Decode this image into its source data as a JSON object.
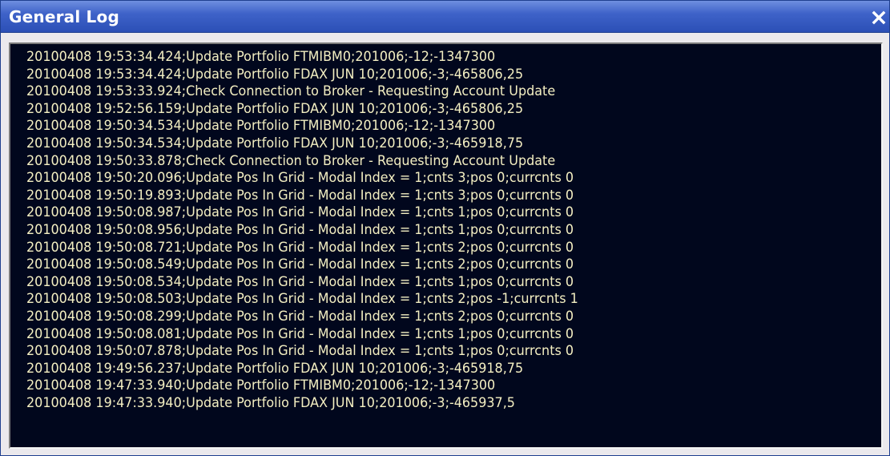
{
  "window": {
    "title": "General Log",
    "close_icon": "close-icon"
  },
  "colors": {
    "titlebar": "#3f63c9",
    "log_background": "#01071d",
    "log_text": "#f4efc2",
    "frame": "#ebe9ed"
  },
  "log": {
    "lines": [
      "20100408 19:53:34.424;Update Portfolio FTMIBM0;201006;-12;-1347300",
      "20100408 19:53:34.424;Update Portfolio FDAX JUN 10;201006;-3;-465806,25",
      "20100408 19:53:33.924;Check Connection to Broker - Requesting Account Update",
      "20100408 19:52:56.159;Update Portfolio FDAX JUN 10;201006;-3;-465806,25",
      "20100408 19:50:34.534;Update Portfolio FTMIBM0;201006;-12;-1347300",
      "20100408 19:50:34.534;Update Portfolio FDAX JUN 10;201006;-3;-465918,75",
      "20100408 19:50:33.878;Check Connection to Broker - Requesting Account Update",
      "20100408 19:50:20.096;Update Pos In Grid - Modal Index = 1;cnts 3;pos 0;currcnts 0",
      "20100408 19:50:19.893;Update Pos In Grid - Modal Index = 1;cnts 3;pos 0;currcnts 0",
      "20100408 19:50:08.987;Update Pos In Grid - Modal Index = 1;cnts 1;pos 0;currcnts 0",
      "20100408 19:50:08.956;Update Pos In Grid - Modal Index = 1;cnts 1;pos 0;currcnts 0",
      "20100408 19:50:08.721;Update Pos In Grid - Modal Index = 1;cnts 2;pos 0;currcnts 0",
      "20100408 19:50:08.549;Update Pos In Grid - Modal Index = 1;cnts 2;pos 0;currcnts 0",
      "20100408 19:50:08.534;Update Pos In Grid - Modal Index = 1;cnts 1;pos 0;currcnts 0",
      "20100408 19:50:08.503;Update Pos In Grid - Modal Index = 1;cnts 2;pos -1;currcnts 1",
      "20100408 19:50:08.299;Update Pos In Grid - Modal Index = 1;cnts 2;pos 0;currcnts 0",
      "20100408 19:50:08.081;Update Pos In Grid - Modal Index = 1;cnts 1;pos 0;currcnts 0",
      "20100408 19:50:07.878;Update Pos In Grid - Modal Index = 1;cnts 1;pos 0;currcnts 0",
      "20100408 19:49:56.237;Update Portfolio FDAX JUN 10;201006;-3;-465918,75",
      "20100408 19:47:33.940;Update Portfolio FTMIBM0;201006;-12;-1347300",
      "20100408 19:47:33.940;Update Portfolio FDAX JUN 10;201006;-3;-465937,5"
    ]
  }
}
